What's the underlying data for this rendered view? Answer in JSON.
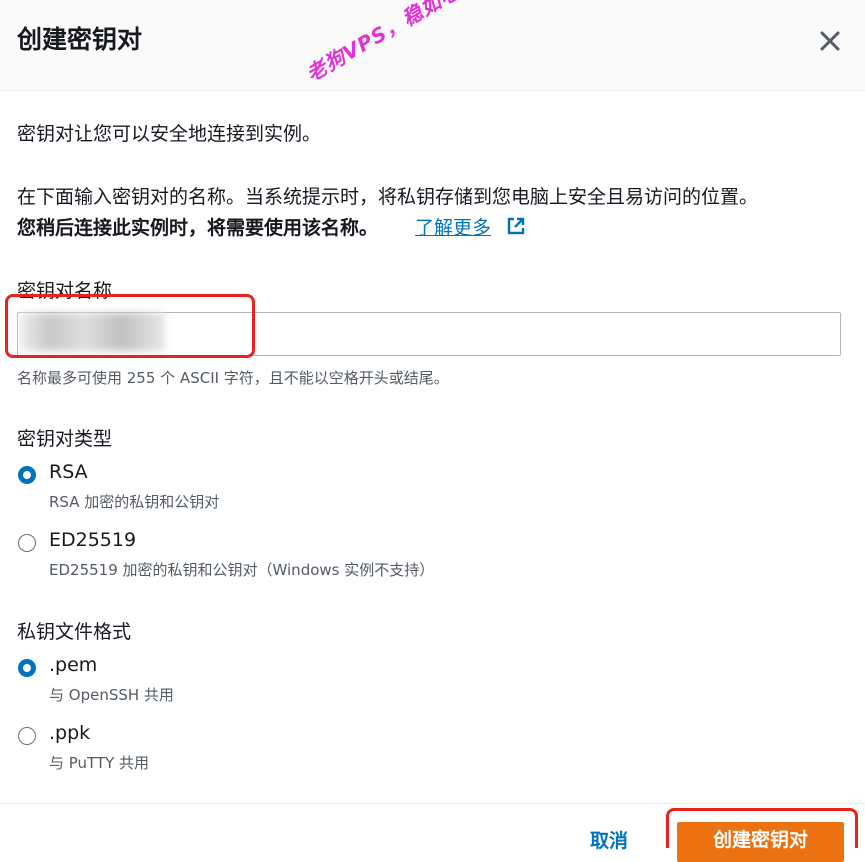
{
  "dialog": {
    "title": "创建密钥对",
    "watermark": "老狗VPS，稳如老狗！",
    "intro": "密钥对让您可以安全地连接到实例。",
    "description": "在下面输入密钥对的名称。当系统提示时，将私钥存储到您电脑上安全且易访问的位置。",
    "description_bold": "您稍后连接此实例时，将需要使用该名称。",
    "learn_more": "了解更多"
  },
  "key_name": {
    "label": "密钥对名称",
    "value": "",
    "hint": "名称最多可使用 255 个 ASCII 字符，且不能以空格开头或结尾。"
  },
  "key_type": {
    "label": "密钥对类型",
    "options": [
      {
        "label": "RSA",
        "description": "RSA 加密的私钥和公钥对",
        "selected": true
      },
      {
        "label": "ED25519",
        "description": "ED25519 加密的私钥和公钥对（Windows 实例不支持）",
        "selected": false
      }
    ]
  },
  "file_format": {
    "label": "私钥文件格式",
    "options": [
      {
        "label": ".pem",
        "description": "与 OpenSSH 共用",
        "selected": true
      },
      {
        "label": ".ppk",
        "description": "与 PuTTY 共用",
        "selected": false
      }
    ]
  },
  "footer": {
    "cancel_label": "取消",
    "create_label": "创建密钥对"
  },
  "colors": {
    "accent": "#0073bb",
    "primary_button": "#ec7211",
    "annotation_red": "#e8231f",
    "watermark": "#e033d6"
  },
  "icons": {
    "close": "close-icon",
    "external_link": "external-link-icon",
    "radio_selected": "radio-selected-icon",
    "radio_unselected": "radio-unselected-icon"
  }
}
